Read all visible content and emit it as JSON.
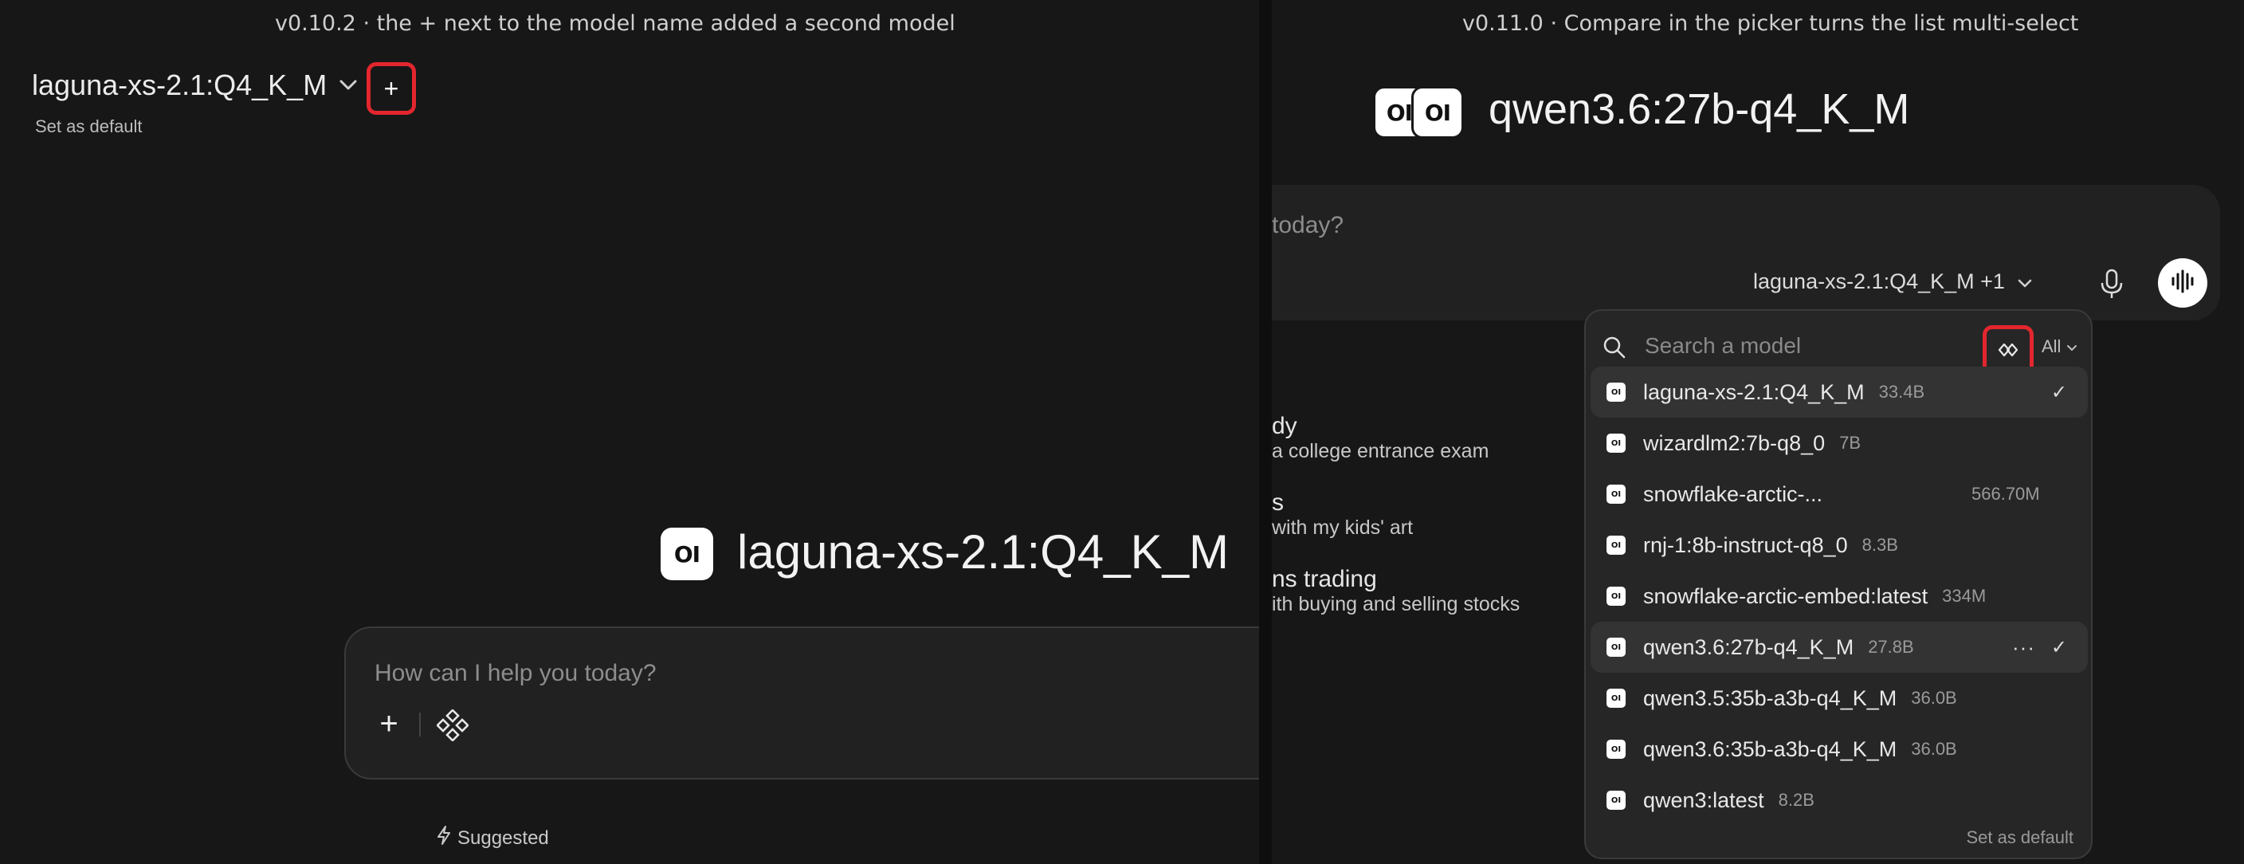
{
  "left": {
    "caption": "v0.10.2 · the + next to the model name added a second model",
    "model_name": "laguna-xs-2.1:Q4_K_M",
    "add_button": "+",
    "set_default": "Set as default",
    "logo_text": "OI",
    "title": "laguna-xs-2.1:Q4_K_M",
    "composer": {
      "placeholder": "How can I help you today?",
      "plus_label": "+"
    },
    "suggested": "Suggested"
  },
  "right": {
    "caption": "v0.11.0 · Compare in the picker turns the list multi-select",
    "logo_text": "OI",
    "title": "qwen3.6:27b-q4_K_M",
    "composer": {
      "placeholder_partial": "today?",
      "model_pill": "laguna-xs-2.1:Q4_K_M +1"
    },
    "suggestions": [
      {
        "title": "dy",
        "subtitle": "a college entrance exam"
      },
      {
        "title": "s",
        "subtitle": "with my kids' art"
      },
      {
        "title": "ns trading",
        "subtitle": "ith buying and selling stocks"
      }
    ],
    "dropdown": {
      "search_placeholder": "Search a model",
      "filter_label": "All",
      "items": [
        {
          "name": "laguna-xs-2.1:Q4_K_M",
          "size": "33.4B",
          "selected": true,
          "checked": true,
          "more": false
        },
        {
          "name": "wizardlm2:7b-q8_0",
          "size": "7B",
          "selected": false,
          "checked": false,
          "more": false
        },
        {
          "name": "snowflake-arctic-...",
          "size": "566.70M",
          "selected": false,
          "checked": false,
          "more": false
        },
        {
          "name": "rnj-1:8b-instruct-q8_0",
          "size": "8.3B",
          "selected": false,
          "checked": false,
          "more": false
        },
        {
          "name": "snowflake-arctic-embed:latest",
          "size": "334M",
          "selected": false,
          "checked": false,
          "more": false
        },
        {
          "name": "qwen3.6:27b-q4_K_M",
          "size": "27.8B",
          "selected": true,
          "checked": true,
          "more": true
        },
        {
          "name": "qwen3.5:35b-a3b-q4_K_M",
          "size": "36.0B",
          "selected": false,
          "checked": false,
          "more": false
        },
        {
          "name": "qwen3.6:35b-a3b-q4_K_M",
          "size": "36.0B",
          "selected": false,
          "checked": false,
          "more": false
        },
        {
          "name": "qwen3:latest",
          "size": "8.2B",
          "selected": false,
          "checked": false,
          "more": false
        }
      ],
      "check_glyph": "✓",
      "more_glyph": "···",
      "footer": "Set as default"
    }
  },
  "colors": {
    "background": "#171717",
    "highlight": "#e3262e",
    "dropdown_bg": "#262626"
  }
}
